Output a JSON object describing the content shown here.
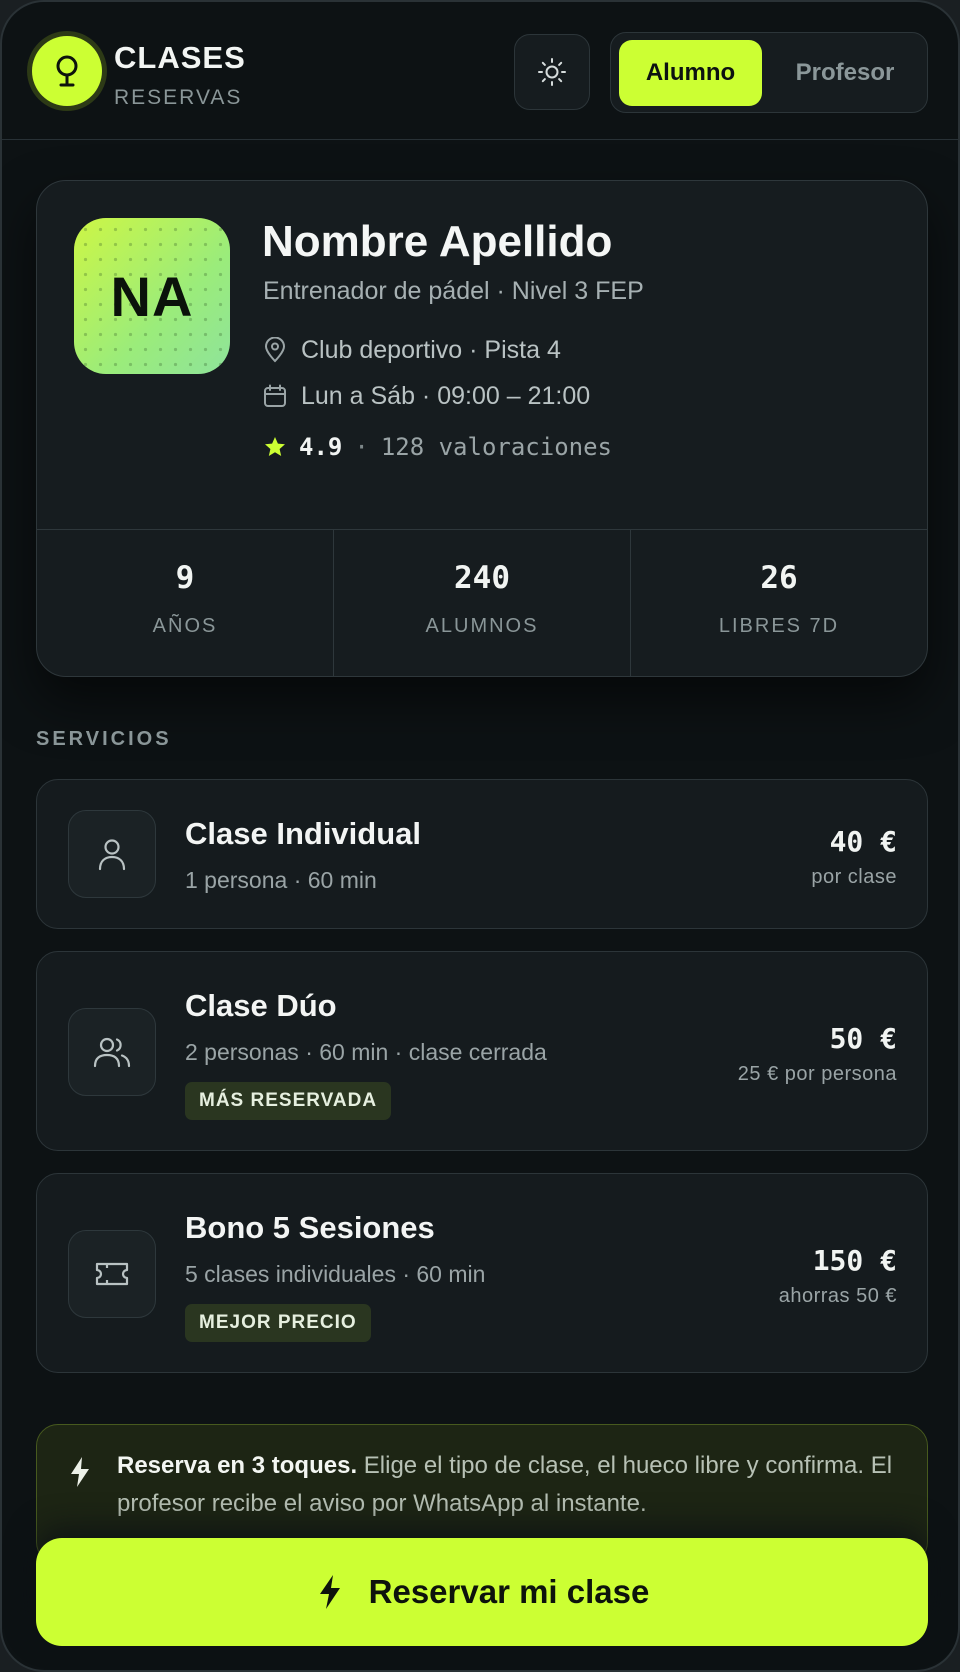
{
  "header": {
    "title": "CLASES",
    "subtitle": "RESERVAS",
    "role_toggle": {
      "active": "Alumno",
      "inactive": "Profesor"
    }
  },
  "profile": {
    "initials": "NA",
    "name": "Nombre Apellido",
    "role": "Entrenador de pádel · Nivel 3 FEP",
    "location": "Club deportivo · Pista 4",
    "schedule": "Lun a Sáb · 09:00 – 21:00",
    "rating": "4.9",
    "rating_separator": "·",
    "reviews": "128 valoraciones",
    "stats": [
      {
        "value": "9",
        "label": "AÑOS"
      },
      {
        "value": "240",
        "label": "ALUMNOS"
      },
      {
        "value": "26",
        "label": "LIBRES 7D"
      }
    ]
  },
  "services": {
    "title": "SERVICIOS",
    "items": [
      {
        "title": "Clase Individual",
        "subtitle": "1 persona · 60 min",
        "price": "40 €",
        "note": "por clase",
        "icon": "user-icon"
      },
      {
        "title": "Clase Dúo",
        "subtitle": "2 personas · 60 min · clase cerrada",
        "badge": "MÁS RESERVADA",
        "price": "50 €",
        "note": "25 € por persona",
        "icon": "users-icon"
      },
      {
        "title": "Bono 5 Sesiones",
        "subtitle": "5 clases individuales · 60 min",
        "badge": "MEJOR PRECIO",
        "price": "150 €",
        "note": "ahorras 50 €",
        "icon": "ticket-icon"
      }
    ]
  },
  "info": {
    "bold": "Reserva en 3 toques.",
    "text": " Elige el tipo de clase, el hueco libre y confirma. El profesor recibe el aviso por WhatsApp al instante.",
    "icon": "bolt-icon"
  },
  "cta": {
    "label": "Reservar mi clase",
    "icon": "bolt-icon"
  },
  "colors": {
    "accent": "#ccff33",
    "background": "#0d1214",
    "card": "#161c1f"
  }
}
